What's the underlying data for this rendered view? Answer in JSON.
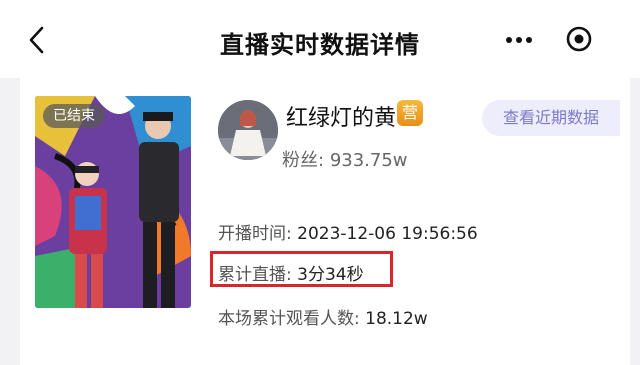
{
  "nav": {
    "title": "直播实时数据详情",
    "back_icon": "chevron-left-icon",
    "more_icon": "more-dots-icon",
    "close_icon": "target-close-icon"
  },
  "live": {
    "cover_status": "已结束",
    "anchor_name": "红绿灯的黄",
    "shop_badge": "营",
    "fans_label": "粉丝:",
    "fans_value": "933.75w",
    "recent_button": "查看近期数据",
    "start_label": "开播时间:",
    "start_value": "2023-12-06 19:56:56",
    "duration_label": "累计直播:",
    "duration_value": "3分34秒",
    "views_label": "本场累计观看人数:",
    "views_value": "18.12w"
  },
  "colors": {
    "highlight": "#d8262c",
    "accent_button_bg": "#eeedfb",
    "accent_button_text": "#7c7ac6",
    "badge_orange": "#f0a52a"
  }
}
